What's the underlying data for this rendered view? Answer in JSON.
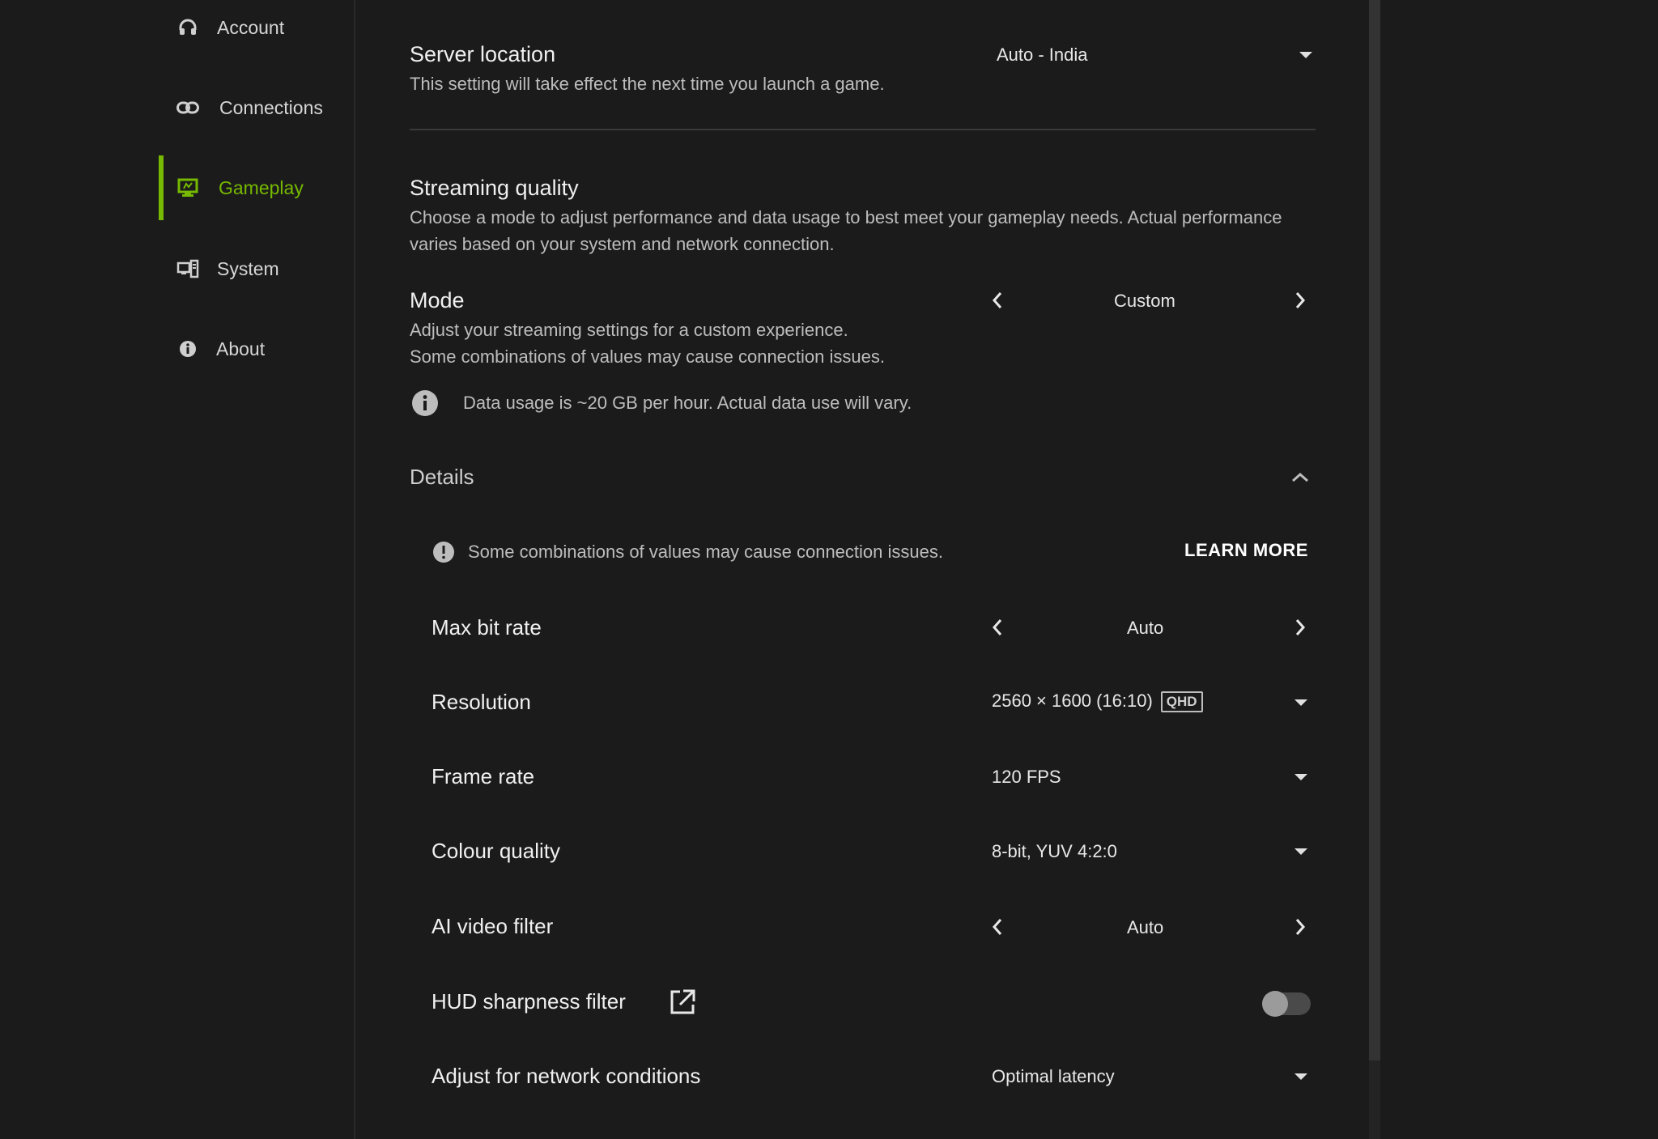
{
  "sidebar": {
    "items": [
      {
        "label": "Account",
        "icon": "headset-icon",
        "active": false
      },
      {
        "label": "Connections",
        "icon": "link-icon",
        "active": false
      },
      {
        "label": "Gameplay",
        "icon": "monitor-icon",
        "active": true
      },
      {
        "label": "System",
        "icon": "devices-icon",
        "active": false
      },
      {
        "label": "About",
        "icon": "info-icon",
        "active": false
      }
    ]
  },
  "server_location": {
    "title": "Server location",
    "description": "This setting will take effect the next time you launch a game.",
    "value": "Auto - India"
  },
  "streaming_quality": {
    "title": "Streaming quality",
    "description": "Choose a mode to adjust performance and data usage to best meet your gameplay needs. Actual performance varies based on your system and network connection."
  },
  "mode": {
    "title": "Mode",
    "description_line1": "Adjust your streaming settings for a custom experience.",
    "description_line2": "Some combinations of values may cause connection issues.",
    "value": "Custom"
  },
  "data_usage": "Data usage is ~20 GB per hour. Actual data use will vary.",
  "details": {
    "title": "Details",
    "warning": "Some combinations of values may cause connection issues.",
    "learn_more": "LEARN MORE"
  },
  "settings": {
    "max_bit_rate": {
      "label": "Max bit rate",
      "value": "Auto"
    },
    "resolution": {
      "label": "Resolution",
      "value": "2560 × 1600 (16:10)",
      "badge": "QHD"
    },
    "frame_rate": {
      "label": "Frame rate",
      "value": "120 FPS"
    },
    "colour_quality": {
      "label": "Colour quality",
      "value": "8-bit, YUV 4:2:0"
    },
    "ai_video_filter": {
      "label": "AI video filter",
      "value": "Auto"
    },
    "hud_sharpness_filter": {
      "label": "HUD sharpness filter",
      "enabled": false
    },
    "network_conditions": {
      "label": "Adjust for network conditions",
      "value": "Optimal latency"
    }
  },
  "colors": {
    "accent": "#76b900",
    "background": "#1b1b1b"
  }
}
